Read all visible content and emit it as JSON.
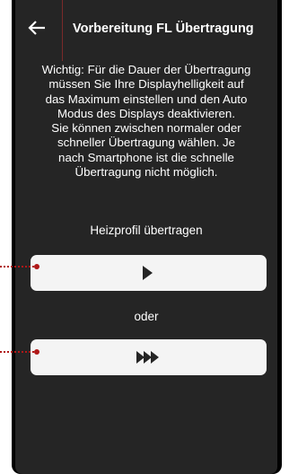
{
  "header": {
    "title": "Vorbereitung FL Übertragung",
    "back_icon": "arrow-left-icon"
  },
  "info_text": "Wichtig: Für die Dauer der Übertragung\nmüssen Sie Ihre Displayhelligkeit auf\ndas Maximum einstellen und den Auto\nModus des Displays deaktivieren.\nSie können zwischen normaler oder\nschneller Übertragung wählen.  Je\nnach Smartphone ist die schnelle\nÜbertragung nicht möglich.",
  "section_label": "Heizprofil übertragen",
  "buttons": {
    "normal_icon": "play-icon",
    "fast_icon": "fast-forward-icon"
  },
  "or_label": "oder",
  "colors": {
    "screen_background": "#252525",
    "button_background": "#f4f4f4",
    "icon_color": "#252525",
    "annotation_red": "#b01818"
  }
}
